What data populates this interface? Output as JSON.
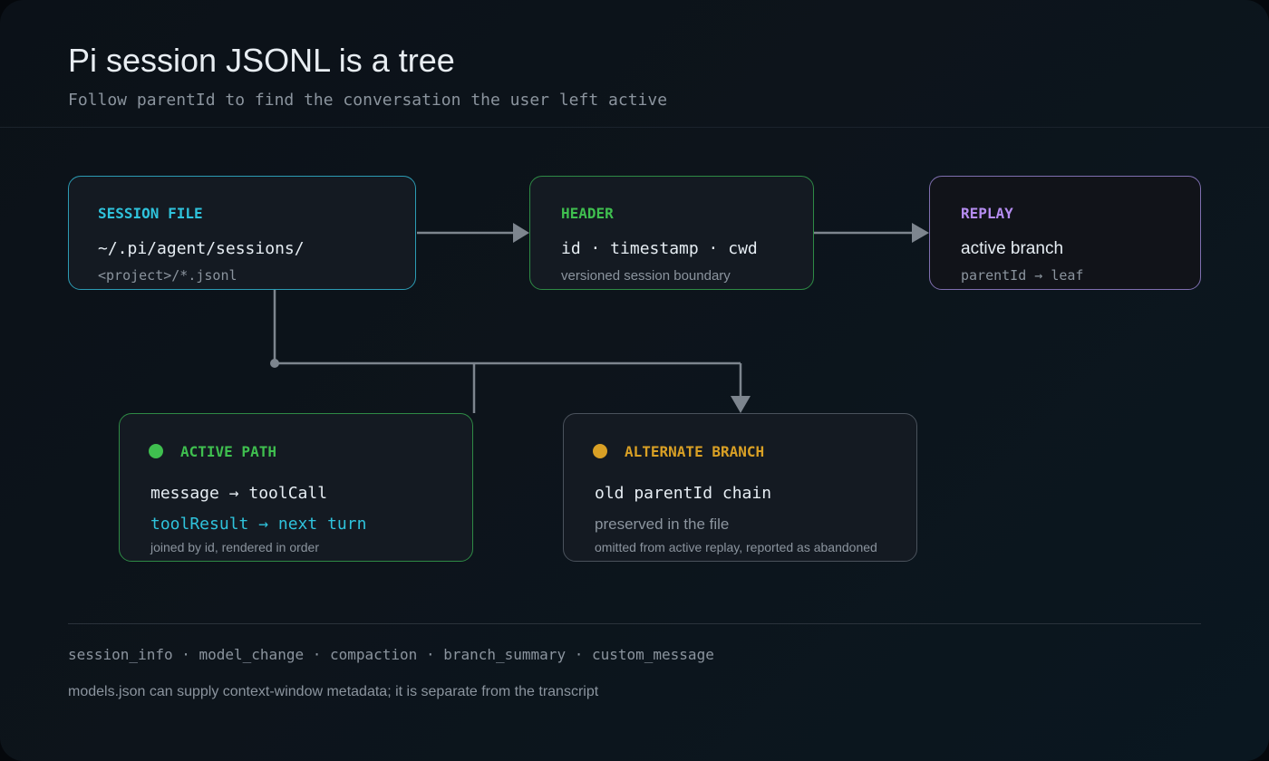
{
  "title": "Pi session JSONL is a tree",
  "subtitle": "Follow parentId to find the conversation the user left active",
  "nodes": {
    "session_file": {
      "label": "SESSION FILE",
      "line1": "~/.pi/agent/sessions/",
      "line2": "<project>/*.jsonl"
    },
    "header": {
      "label": "HEADER",
      "line1": "id · timestamp · cwd",
      "line2": "versioned session boundary"
    },
    "replay": {
      "label": "REPLAY",
      "line1": "active branch",
      "line2": "parentId → leaf"
    },
    "active_path": {
      "label": "ACTIVE PATH",
      "line1": "message → toolCall",
      "line2": "toolResult → next turn",
      "note": "joined by id, rendered in order"
    },
    "alternate_branch": {
      "label": "ALTERNATE BRANCH",
      "line1": "old parentId chain",
      "line2": "preserved in the file",
      "note": "omitted from active replay, reported as abandoned"
    }
  },
  "footer": {
    "entry_types": "session_info · model_change · compaction · branch_summary · custom_message",
    "note": "models.json can supply context-window metadata; it is separate from the transcript"
  },
  "colors": {
    "cyan": "#2fc3dc",
    "green": "#3fbf4f",
    "purple": "#b58cf0",
    "amber": "#d9a025",
    "connector": "#7d858e"
  }
}
